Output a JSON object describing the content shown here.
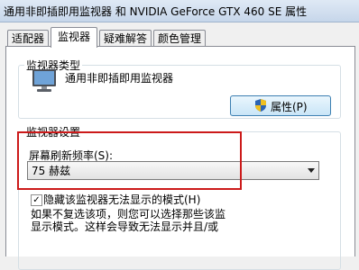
{
  "window": {
    "title": "通用非即插即用监视器 和 NVIDIA GeForce GTX 460 SE 属性"
  },
  "tabs": [
    {
      "label": "适配器"
    },
    {
      "label": "监视器",
      "active": true
    },
    {
      "label": "疑难解答"
    },
    {
      "label": "颜色管理"
    }
  ],
  "monitor_type": {
    "legend": "监视器类型",
    "monitor_name": "通用非即插即用监视器",
    "properties_button": "属性(P)"
  },
  "monitor_settings": {
    "legend": "监视器设置",
    "refresh_label": "屏幕刷新频率(S):",
    "refresh_value": "75 赫兹",
    "hide_modes_checked": true,
    "hide_modes_label": "隐藏该监视器无法显示的模式(H)",
    "hint_line1": "如果不复选该项，则您可以选择那些该监",
    "hint_line2": "显示模式。这样会导致无法显示并且/或"
  },
  "colors": {
    "highlight": "#cc1a1a",
    "button_border": "#3c7fb1"
  }
}
